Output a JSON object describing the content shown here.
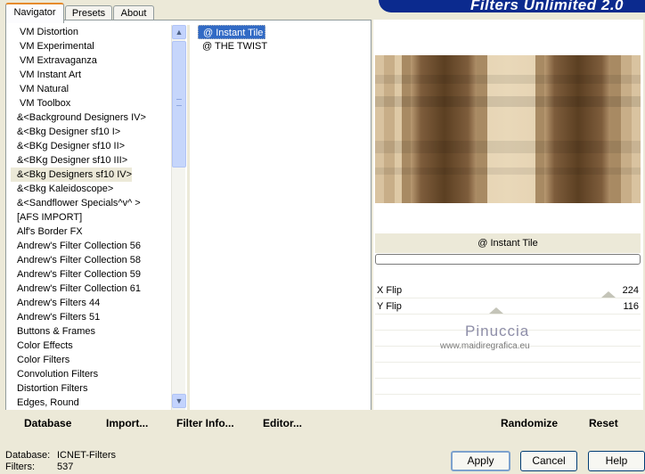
{
  "tabs": [
    {
      "label": "Navigator",
      "active": true
    },
    {
      "label": "Presets",
      "active": false
    },
    {
      "label": "About",
      "active": false
    }
  ],
  "banner": {
    "title": "Filters Unlimited 2.0"
  },
  "categories": [
    "VM Distortion",
    "VM Experimental",
    "VM Extravaganza",
    "VM Instant Art",
    "VM Natural",
    "VM Toolbox",
    "&<Background Designers IV>",
    "&<Bkg Designer sf10 I>",
    "&<BKg Designer sf10 II>",
    "&<BKg Designer sf10 III>",
    "&<Bkg Designers sf10 IV>",
    "&<Bkg Kaleidoscope>",
    "&<Sandflower Specials^v^ >",
    "[AFS IMPORT]",
    "Alf's Border FX",
    "Andrew's Filter Collection 56",
    "Andrew's Filter Collection 58",
    "Andrew's Filter Collection 59",
    "Andrew's Filter Collection 61",
    "Andrew's Filters 44",
    "Andrew's Filters 51",
    "Buttons & Frames",
    "Color Effects",
    "Color Filters",
    "Convolution Filters",
    "Distortion Filters",
    "Edges, Round"
  ],
  "selected_category_index": 10,
  "filters": [
    {
      "label": "@ Instant Tile",
      "selected": true
    },
    {
      "label": "@ THE TWIST",
      "selected": false
    }
  ],
  "left_buttons": {
    "database": "Database",
    "import": "Import...",
    "filter_info": "Filter Info...",
    "editor": "Editor..."
  },
  "preview": {
    "filter_name": "@ Instant Tile",
    "progress": 0
  },
  "sliders": [
    {
      "label": "X Flip",
      "value": "224"
    },
    {
      "label": "Y Flip",
      "value": "116"
    }
  ],
  "right_buttons": {
    "randomize": "Randomize",
    "reset": "Reset"
  },
  "watermark": {
    "name": "Pinuccia",
    "url": "www.maidiregrafica.eu"
  },
  "status": {
    "database_label": "Database:",
    "database_value": "ICNET-Filters",
    "filters_label": "Filters:",
    "filters_value": "537"
  },
  "dialog_buttons": {
    "apply": "Apply",
    "cancel": "Cancel",
    "help": "Help"
  },
  "colors": {
    "window_bg": "#ECE9D8",
    "selection": "#316AC5",
    "banner": "#0B2A8E",
    "tab_accent": "#E68B2C"
  }
}
